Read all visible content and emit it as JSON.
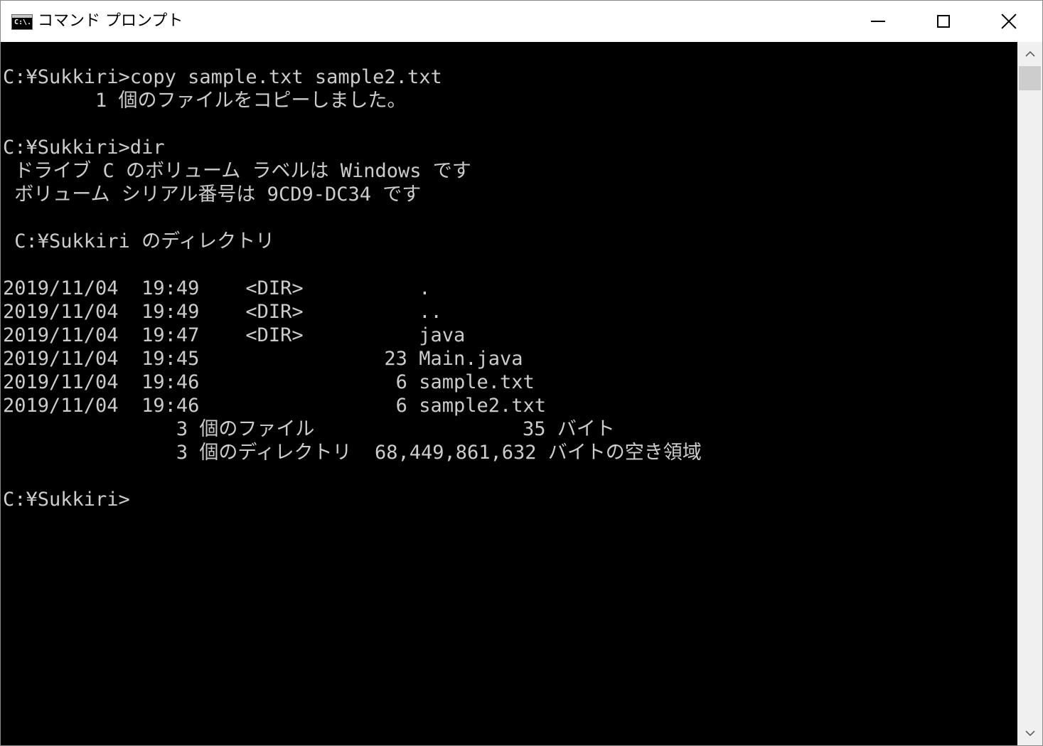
{
  "window": {
    "title": "コマンド プロンプト",
    "icon_label": "C:\\."
  },
  "controls": {
    "minimize": "minimize",
    "maximize": "maximize",
    "close": "close"
  },
  "console": {
    "lines": [
      "",
      "C:¥Sukkiri>copy sample.txt sample2.txt",
      "        1 個のファイルをコピーしました。",
      "",
      "C:¥Sukkiri>dir",
      " ドライブ C のボリューム ラベルは Windows です",
      " ボリューム シリアル番号は 9CD9-DC34 です",
      "",
      " C:¥Sukkiri のディレクトリ",
      "",
      "2019/11/04  19:49    <DIR>          .",
      "2019/11/04  19:49    <DIR>          ..",
      "2019/11/04  19:47    <DIR>          java",
      "2019/11/04  19:45                23 Main.java",
      "2019/11/04  19:46                 6 sample.txt",
      "2019/11/04  19:46                 6 sample2.txt",
      "               3 個のファイル                  35 バイト",
      "               3 個のディレクトリ  68,449,861,632 バイトの空き領域",
      "",
      "C:¥Sukkiri>"
    ]
  },
  "scrollbar": {
    "up_arrow": "^",
    "down_arrow": "v"
  }
}
